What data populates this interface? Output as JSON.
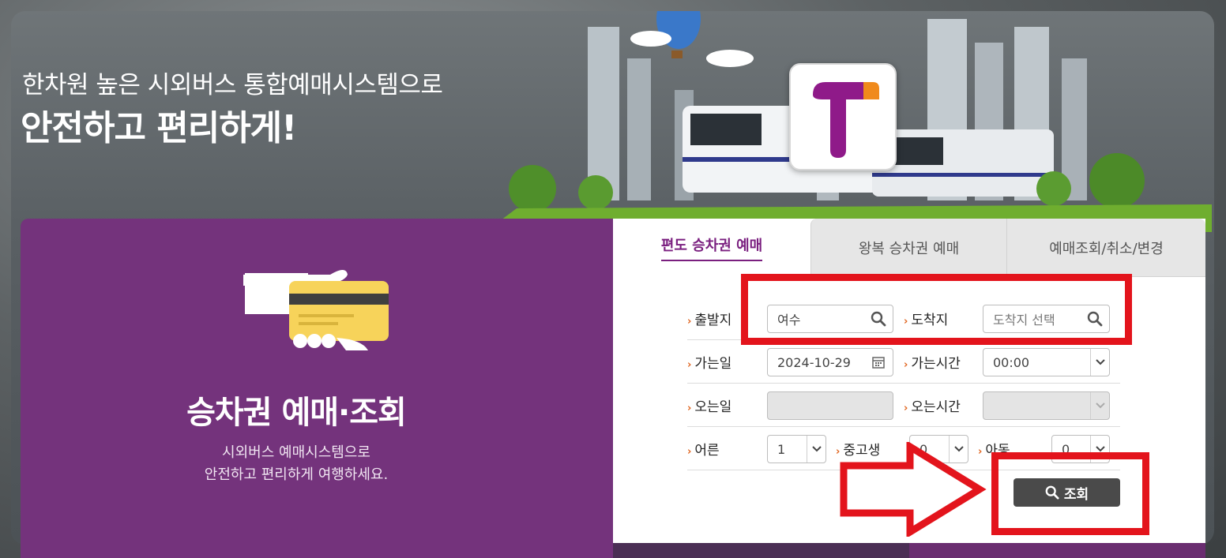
{
  "hero": {
    "title_line1": "한차원 높은 시외버스 통합예매시스템으로",
    "title_line2": "안전하고 편리하게!"
  },
  "promo": {
    "title": "승차권 예매·조회",
    "desc_line1": "시외버스 예매시스템으로",
    "desc_line2": "안전하고 편리하게 여행하세요."
  },
  "tabs": [
    {
      "label": "편도 승차권 예매",
      "active": true
    },
    {
      "label": "왕복 승차권 예매",
      "active": false
    },
    {
      "label": "예매조회/취소/변경",
      "active": false
    }
  ],
  "form": {
    "departure": {
      "label": "출발지",
      "value": "여수"
    },
    "arrival": {
      "label": "도착지",
      "placeholder": "도착지 선택"
    },
    "go_date": {
      "label": "가는일",
      "value": "2024-10-29"
    },
    "go_time": {
      "label": "가는시간",
      "value": "00:00"
    },
    "return_date": {
      "label": "오는일",
      "value": ""
    },
    "return_time": {
      "label": "오는시간",
      "value": ""
    },
    "adult": {
      "label": "어른",
      "value": "1"
    },
    "student": {
      "label": "중고생",
      "value": "0"
    },
    "child": {
      "label": "아동",
      "value": "0"
    }
  },
  "search_button": {
    "label": "조회"
  },
  "colors": {
    "purple": "#74337c",
    "accent_red": "#e3141c",
    "chevron_orange": "#e0651f",
    "button_dark": "#4a4a4a"
  }
}
